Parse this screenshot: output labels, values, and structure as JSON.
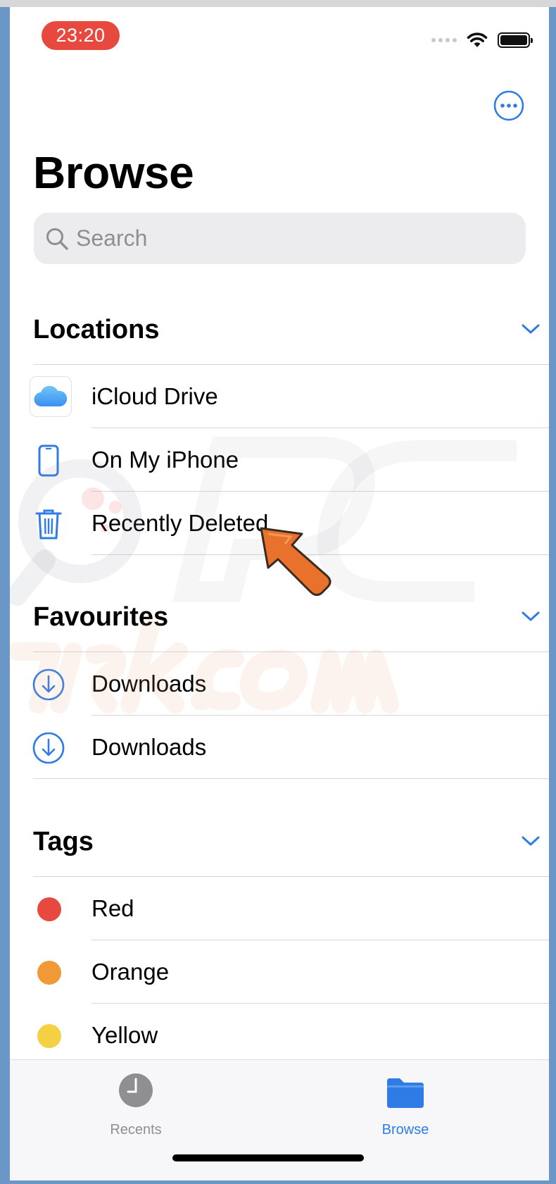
{
  "status_bar": {
    "time": "23:20"
  },
  "header": {
    "title": "Browse"
  },
  "search": {
    "placeholder": "Search"
  },
  "locations": {
    "label": "Locations",
    "items": [
      {
        "label": "iCloud Drive",
        "icon": "icloud-icon"
      },
      {
        "label": "On My iPhone",
        "icon": "iphone-icon"
      },
      {
        "label": "Recently Deleted",
        "icon": "trash-icon"
      }
    ]
  },
  "favourites": {
    "label": "Favourites",
    "items": [
      {
        "label": "Downloads",
        "icon": "download-icon"
      },
      {
        "label": "Downloads",
        "icon": "download-icon"
      }
    ]
  },
  "tags": {
    "label": "Tags",
    "items": [
      {
        "label": "Red",
        "color": "#e7493f"
      },
      {
        "label": "Orange",
        "color": "#f09a37"
      },
      {
        "label": "Yellow",
        "color": "#f6d043"
      }
    ]
  },
  "tabbar": {
    "recents": "Recents",
    "browse": "Browse"
  },
  "colors": {
    "accent": "#2f7ce6",
    "inactive": "#8e8e93"
  }
}
